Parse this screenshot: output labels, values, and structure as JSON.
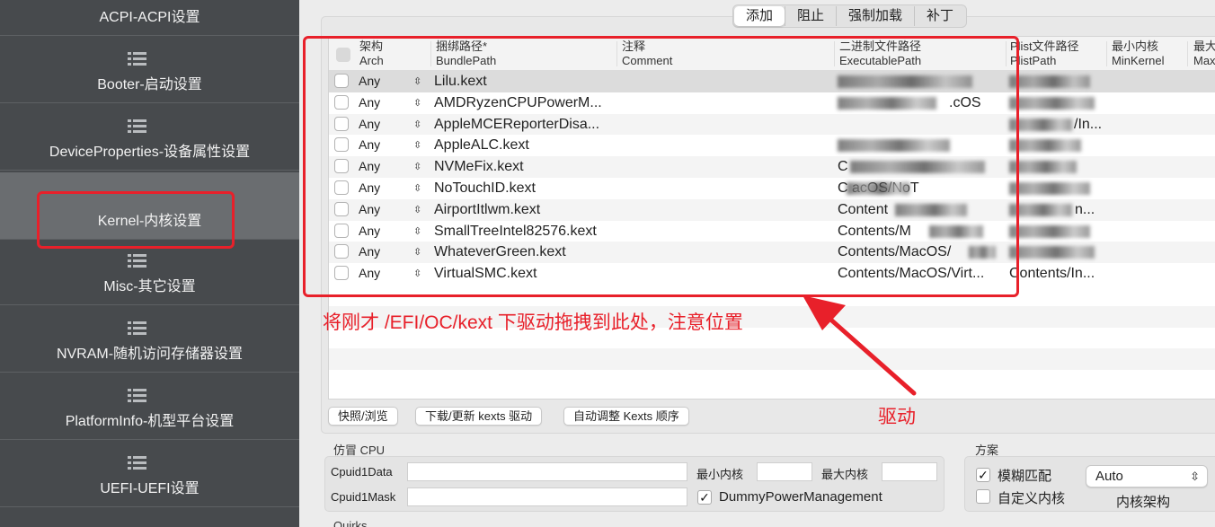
{
  "sidebar": {
    "items": [
      {
        "label": "ACPI-ACPI设置",
        "active": false
      },
      {
        "label": "Booter-启动设置",
        "active": false
      },
      {
        "label": "DeviceProperties-设备属性设置",
        "active": false
      },
      {
        "label": "Kernel-内核设置",
        "active": true
      },
      {
        "label": "Misc-其它设置",
        "active": false
      },
      {
        "label": "NVRAM-随机访问存储器设置",
        "active": false
      },
      {
        "label": "PlatformInfo-机型平台设置",
        "active": false
      },
      {
        "label": "UEFI-UEFI设置",
        "active": false
      }
    ]
  },
  "segmented": {
    "options": [
      "添加",
      "阻止",
      "强制加载",
      "补丁"
    ],
    "selected": "添加"
  },
  "table": {
    "headers": {
      "arch_cn": "架构",
      "arch_en": "Arch",
      "bundle_cn": "捆绑路径*",
      "bundle_en": "BundlePath",
      "comment_cn": "注释",
      "comment_en": "Comment",
      "exec_cn": "二进制文件路径",
      "exec_en": "ExecutablePath",
      "plist_cn": "Plist文件路径",
      "plist_en": "PlistPath",
      "minkernel_cn": "最小内核",
      "minkernel_en": "MinKernel",
      "maxkernel_cn": "最大",
      "maxkernel_en": "Max"
    },
    "rows": [
      {
        "arch": "Any",
        "bundle": "Lilu.kext",
        "exec": "",
        "plist": ""
      },
      {
        "arch": "Any",
        "bundle": "AMDRyzenCPUPowerM...",
        "exec": ".cOS",
        "plist": ""
      },
      {
        "arch": "Any",
        "bundle": "AppleMCEReporterDisa...",
        "exec": "",
        "plist": "/In..."
      },
      {
        "arch": "Any",
        "bundle": "AppleALC.kext",
        "exec": "",
        "plist": ""
      },
      {
        "arch": "Any",
        "bundle": "NVMeFix.kext",
        "exec": "C",
        "plist": ""
      },
      {
        "arch": "Any",
        "bundle": "NoTouchID.kext",
        "exec": "C acOS/NoT",
        "plist": ""
      },
      {
        "arch": "Any",
        "bundle": "AirportItlwm.kext",
        "exec": "Content",
        "plist": "n..."
      },
      {
        "arch": "Any",
        "bundle": "SmallTreeIntel82576.kext",
        "exec": "Contents/M",
        "plist": ""
      },
      {
        "arch": "Any",
        "bundle": "WhateverGreen.kext",
        "exec": "Contents/MacOS/",
        "plist": ""
      },
      {
        "arch": "Any",
        "bundle": "VirtualSMC.kext",
        "exec": "Contents/MacOS/Virt...",
        "plist": "Contents/In..."
      }
    ]
  },
  "buttons": {
    "snapshot": "快照/浏览",
    "download": "下载/更新 kexts 驱动",
    "auto_order": "自动调整 Kexts 顺序"
  },
  "cpu": {
    "section_title": "仿冒 CPU",
    "cpuid1data_label": "Cpuid1Data",
    "cpuid1mask_label": "Cpuid1Mask",
    "min_kernel_label": "最小内核",
    "max_kernel_label": "最大内核",
    "dummy_power_label": "DummyPowerManagement",
    "dummy_power_checked": true
  },
  "scheme": {
    "section_title": "方案",
    "fuzzy_match_label": "模糊匹配",
    "fuzzy_match_checked": true,
    "custom_kernel_label": "自定义内核",
    "custom_kernel_checked": false,
    "arch_select_value": "Auto",
    "arch_label": "内核架构"
  },
  "bottom_cut_label": "Quirks",
  "annotations": {
    "instruction": "将刚才 /EFI/OC/kext 下驱动拖拽到此处，注意位置",
    "driver_label": "驱动",
    "color": "#e8202a"
  }
}
